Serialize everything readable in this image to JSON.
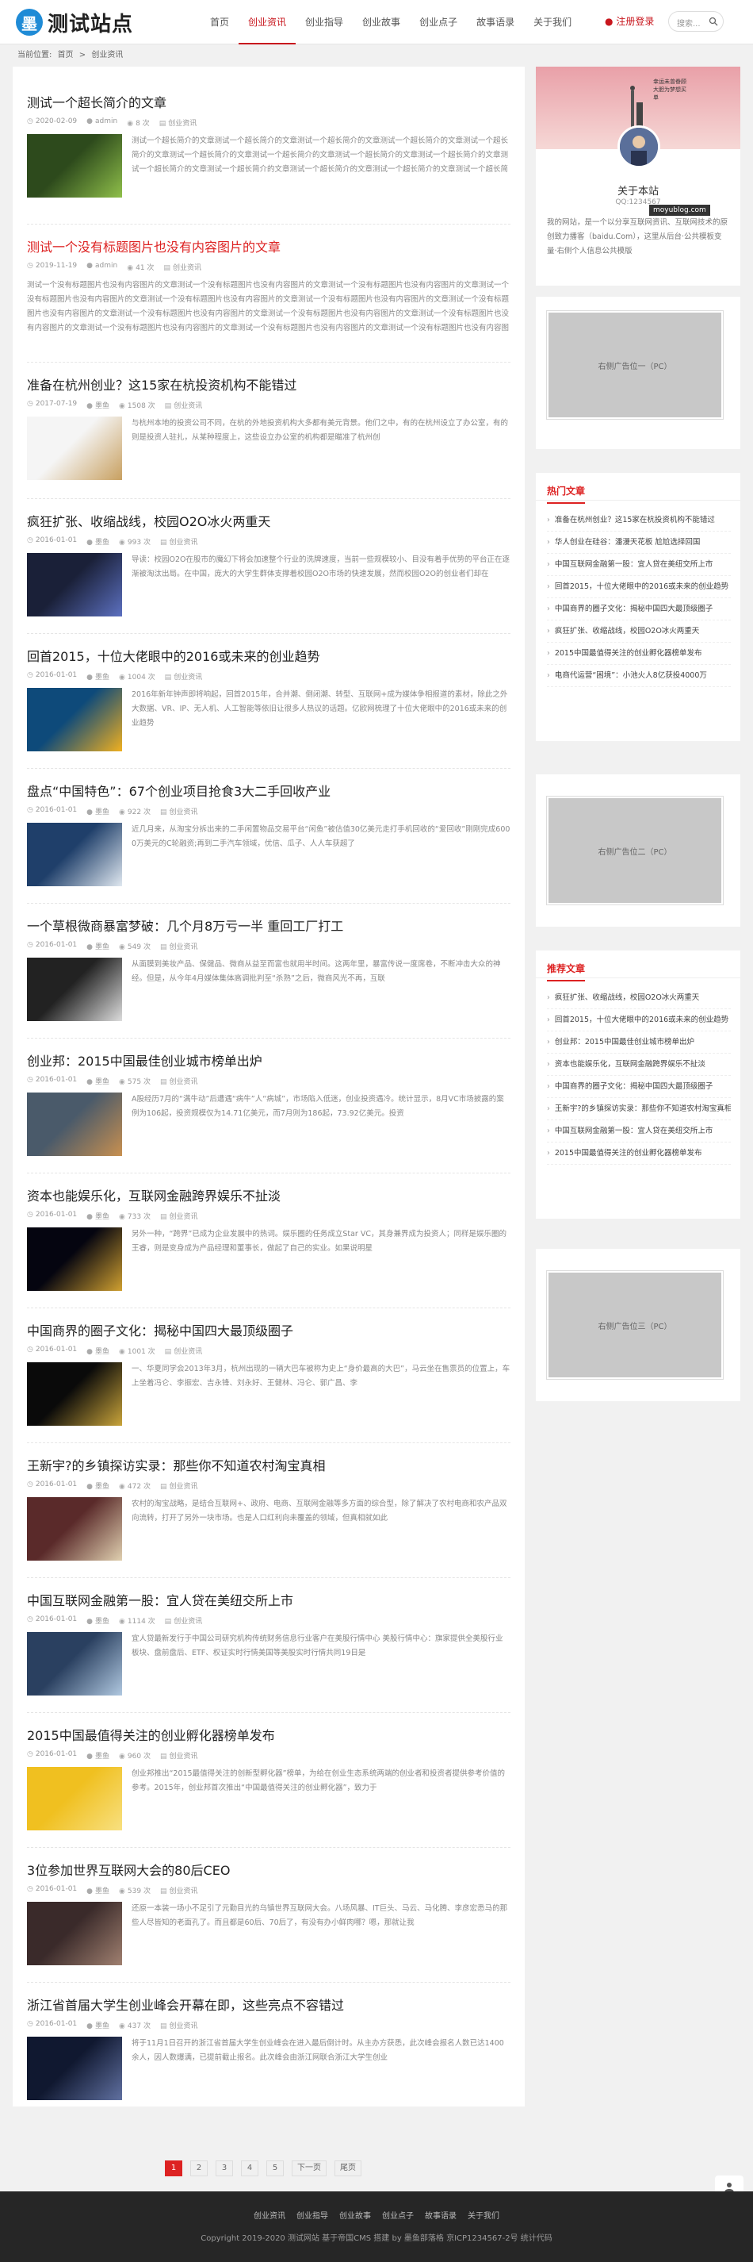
{
  "header": {
    "logo_mark": "墨",
    "site_name": "测试站点",
    "nav": [
      "首页",
      "创业资讯",
      "创业指导",
      "创业故事",
      "创业点子",
      "故事语录",
      "关于我们"
    ],
    "active_nav": "创业资讯",
    "register": "注册登录",
    "search_placeholder": "搜索..."
  },
  "breadcrumb": {
    "prefix": "当前位置:",
    "home": "首页",
    "sep": ">",
    "current": "创业资讯"
  },
  "articles": [
    {
      "title": "测试一个超长简介的文章",
      "date": "2020-02-09",
      "author": "admin",
      "views": "8 次",
      "category": "创业资讯",
      "summary": "测试一个超长简介的文章测试一个超长简介的文章测试一个超长简介的文章测试一个超长简介的文章测试一个超长简介的文章测试一个超长简介的文章测试一个超长简介的文章测试一个超长简介的文章测试一个超长简介的文章测试一个超长简介的文章测试一个超长简介的文章测试一个超长简介的文章测试一个超长简介的文章测试一个超长简介的文章测试一个超长简介的文章测试一个超长简介的文章测试一个超长简介的文章"
    },
    {
      "title": "测试一个没有标题图片也没有内容图片的文章",
      "date": "2019-11-19",
      "author": "admin",
      "views": "41 次",
      "category": "创业资讯",
      "summary": "测试一个没有标题图片也没有内容图片的文章测试一个没有标题图片也没有内容图片的文章测试一个没有标题图片也没有内容图片的文章测试一个没有标题图片也没有内容图片的文章测试一个没有标题图片也没有内容图片的文章测试一个没有标题图片也没有内容图片的文章测试一个没有标题图片也没有内容图片的文章测试一个没有标题图片也没有内容图片的文章测试一个没有标题图片也没有内容图片的文章测试一个没有标题图片也没有内容图片的文章测试一个没有标题图片也没有内容图片的文章测试一个没有标题图片也没有内容图片的文章测试一个没有标题图片也没有内容图片的文章测试一个没有标题图片也没有内容图片的文章"
    },
    {
      "title": "准备在杭州创业？这15家在杭投资机构不能错过",
      "date": "2017-07-19",
      "author": "墨鱼",
      "views": "1508 次",
      "category": "创业资讯",
      "summary": "与杭州本地的投资公司不同，在杭的外地投资机构大多都有美元背景。他们之中，有的在杭州设立了办公室，有的则是投资人驻扎，从某种程度上，这些设立办公室的机构都是瞄准了杭州创"
    },
    {
      "title": "疯狂扩张、收缩战线，校园O2O冰火两重天",
      "date": "2016-01-01",
      "author": "墨鱼",
      "views": "993 次",
      "category": "创业资讯",
      "summary": "导读：校园O2O在股市的魔幻下将会加速整个行业的洗牌速度，当前一些规模较小、目没有着手优势的平台正在逐渐被淘汰出局。在中国，庞大的大学生群体支撑着校园O2O市场的快速发展，然而校园O2O的创业者们却在"
    },
    {
      "title": "回首2015，十位大佬眼中的2016或未来的创业趋势",
      "date": "2016-01-01",
      "author": "墨鱼",
      "views": "1004 次",
      "category": "创业资讯",
      "summary": "2016年新年钟声即将响起，回首2015年，合并潮、倒闭潮、转型、互联网+成为媒体争相报道的素材，除此之外大数据、VR、IP、无人机、人工智能等依旧让很多人热议的话题。亿欧网梳理了十位大佬眼中的2016或未来的创业趋势"
    },
    {
      "title": "盘点“中国特色”：67个创业项目抢食3大二手回收产业",
      "date": "2016-01-01",
      "author": "墨鱼",
      "views": "922 次",
      "category": "创业资讯",
      "summary": "近几月来，从淘宝分拆出来的二手闲置物品交易平台“闲鱼”被估值30亿美元走打手机回收的“爱回收”刚刚完成6000万美元的C轮融资;再到二手汽车领域，优信、瓜子、人人车获超了"
    },
    {
      "title": "一个草根微商暴富梦破：几个月8万亏一半 重回工厂打工",
      "date": "2016-01-01",
      "author": "墨鱼",
      "views": "549 次",
      "category": "创业资讯",
      "summary": "从面膜到美妆产品、保健品、微商从益至而富也就用半时间。这两年里，暴富传说一度席卷，不断冲击大众的神经。但是，从今年4月媒体集体高调批判至“杀熟”之后，微商风光不再，互联"
    },
    {
      "title": "创业邦：2015中国最佳创业城市榜单出炉",
      "date": "2016-01-01",
      "author": "墨鱼",
      "views": "575 次",
      "category": "创业资讯",
      "summary": "A股经历7月的“满牛动”后遭遇“病牛”人“病城”，市场陷入低迷，创业投资遇冷。统计显示，8月VC市场披露的案例为106起，投资规模仅为14.71亿美元，而7月则为186起，73.92亿美元。投资"
    },
    {
      "title": "资本也能娱乐化，互联网金融跨界娱乐不扯淡",
      "date": "2016-01-01",
      "author": "墨鱼",
      "views": "733 次",
      "category": "创业资讯",
      "summary": "另外一种，“跨界”已成为企业发展中的热词。娱乐圈的任务成立Star VC，其身兼界成为投资人；同样是娱乐圈的王睿，则是变身成为产品经理和董事长，做起了自己的实业。如果说明星"
    },
    {
      "title": "中国商界的圈子文化：揭秘中国四大最顶级圈子",
      "date": "2016-01-01",
      "author": "墨鱼",
      "views": "1001 次",
      "category": "创业资讯",
      "summary": "一、华夏同学会2013年3月，杭州出现的一辆大巴车被称为史上“身价最高的大巴”，马云坐在售票员的位置上，车上坐着冯仑、李振宏、吉永锋、刘永好、王健林、冯仑、郭广昌、李"
    },
    {
      "title": "王新宇?的乡镇探访实录：那些你不知道农村淘宝真相",
      "date": "2016-01-01",
      "author": "墨鱼",
      "views": "472 次",
      "category": "创业资讯",
      "summary": "农村的淘宝战略，是结合互联网+、政府、电商、互联网金融等多方面的综合型，除了解决了农村电商和农产品双向流转，打开了另外一块市场。也是人口红利向未覆盖的领域，但真相就如此"
    },
    {
      "title": "中国互联网金融第一股：宜人贷在美纽交所上市",
      "date": "2016-01-01",
      "author": "墨鱼",
      "views": "1114 次",
      "category": "创业资讯",
      "summary": "宜人贷最新发行于中国公司研究机构传统财务信息行业客户在美股行情中心 美股行情中心：旗家提供全美股行业板块、盘前盘后、ETF、权证实时行情美国等美股实时行情共同19日是"
    },
    {
      "title": "2015中国最值得关注的创业孵化器榜单发布",
      "date": "2016-01-01",
      "author": "墨鱼",
      "views": "960 次",
      "category": "创业资讯",
      "summary": "创业邦推出“2015最值得关注的创新型孵化器”榜单，为给在创业生态系统两端的创业者和投资者提供参考价值的参考。2015年，创业邦首次推出“中国最值得关注的创业孵化器”，致力于"
    },
    {
      "title": "3位参加世界互联网大会的80后CEO",
      "date": "2016-01-01",
      "author": "墨鱼",
      "views": "539 次",
      "category": "创业资讯",
      "summary": "还原一本装一场小不足引了元勤目光的乌镇世界互联网大会。八场风暴、IT巨头、马云、马化腾、李彦宏悉马的那些人尽皆知的老面孔了。而且都是60后、70后了，有没有办小鲜肉哪？嗯，那就让我"
    },
    {
      "title": "浙江省首届大学生创业峰会开幕在即，这些亮点不容错过",
      "date": "2016-01-01",
      "author": "墨鱼",
      "views": "437 次",
      "category": "创业资讯",
      "summary": "将于11月1日召开的浙江省首届大学生创业峰会在进入最后倒计时。从主办方获悉，此次峰会报名人数已达1400余人，因人数爆满，已提前截止报名。此次峰会由浙江网联合浙江大学生创业"
    }
  ],
  "pager": [
    "1",
    "2",
    "3",
    "4",
    "5",
    "下一页",
    "尾页"
  ],
  "sidebar": {
    "about": {
      "banner_text": "幸运未曾眷顾 大胆为梦想买单",
      "title": "关于本站",
      "qq": "QQ:1234567",
      "desc": "我的网站，是一个以分享互联网资讯、互联网技术的原创致力播客（baidu.Com），这里从后台·公共模板变量·右侧个人信息公共模版",
      "watermark": "moyublog.com"
    },
    "ad1": "右侧广告位一（PC）",
    "hot_title": "热门文章",
    "hot": [
      "准备在杭州创业？这15家在杭投资机构不能错过",
      "华人创业在硅谷：潘漫天花板 尬尬选择回国",
      "中国互联网金融第一股：宜人贷在美纽交所上市",
      "回首2015，十位大佬眼中的2016或未来的创业趋势",
      "中国商界的圈子文化：揭秘中国四大最顶级圈子",
      "疯狂扩张、收缩战线，校园O2O冰火两重天",
      "2015中国最值得关注的创业孵化器榜单发布",
      "电商代运营“困境”：小池火人8亿获投4000万"
    ],
    "ad2": "右侧广告位二（PC）",
    "rec_title": "推荐文章",
    "rec": [
      "疯狂扩张、收缩战线，校园O2O冰火两重天",
      "回首2015，十位大佬眼中的2016或未来的创业趋势",
      "创业邦：2015中国最佳创业城市榜单出炉",
      "资本也能娱乐化，互联网金融跨界娱乐不扯淡",
      "中国商界的圈子文化：揭秘中国四大最顶级圈子",
      "王新宇?的乡镇探访实录：那些你不知道农村淘宝真相",
      "中国互联网金融第一股：宜人贷在美纽交所上市",
      "2015中国最值得关注的创业孵化器榜单发布"
    ],
    "ad3": "右侧广告位三（PC）"
  },
  "footer": {
    "links": [
      "创业资讯",
      "创业指导",
      "创业故事",
      "创业点子",
      "故事语录",
      "关于我们"
    ],
    "copyright": "Copyright 2019-2020 测试网站 基于帝国CMS 搭建 by 墨鱼部落格 京ICP1234567-2号 统计代码"
  }
}
